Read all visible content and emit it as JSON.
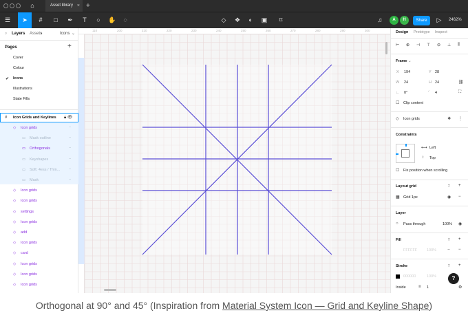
{
  "window": {
    "tab_title": "Asset library",
    "home_icon": "home-icon",
    "close_glyph": "×",
    "new_tab_glyph": "+"
  },
  "toolbar": {
    "share_label": "Share",
    "zoom_label": "2462%",
    "avatars": [
      {
        "initial": "A",
        "color": "#2fb344"
      },
      {
        "initial": "H",
        "color": "#3ab54a"
      }
    ]
  },
  "left_panel": {
    "tabs": {
      "layers": "Layers",
      "assets": "Assets",
      "assets_dot": "•",
      "page_select": "Icons"
    },
    "pages_heading": "Pages",
    "pages": [
      "Cover",
      "Colour",
      "Icons",
      "Illustrations",
      "State Fills"
    ],
    "current_page_index": 2,
    "frame_layer": "Icon Grids and Keylines",
    "layers": [
      {
        "label": "Icon grids",
        "style": "purple",
        "indent": 1
      },
      {
        "label": "Mask outline",
        "style": "grey",
        "indent": 2
      },
      {
        "label": "Orthogonals",
        "style": "purple",
        "indent": 2
      },
      {
        "label": "Keyshapes",
        "style": "grey",
        "indent": 2
      },
      {
        "label": "Soft: 4ess / Thin...",
        "style": "grey",
        "indent": 2
      },
      {
        "label": "Mask",
        "style": "grey",
        "indent": 2
      },
      {
        "label": "Icon grids",
        "style": "purple",
        "indent": 1
      },
      {
        "label": "Icon grids",
        "style": "purple",
        "indent": 1
      },
      {
        "label": "settings",
        "style": "purple",
        "indent": 1
      },
      {
        "label": "Icon grids",
        "style": "purple",
        "indent": 1
      },
      {
        "label": "add",
        "style": "purple",
        "indent": 1
      },
      {
        "label": "Icon grids",
        "style": "purple",
        "indent": 1
      },
      {
        "label": "card",
        "style": "purple",
        "indent": 1
      },
      {
        "label": "Icon grids",
        "style": "purple",
        "indent": 1
      },
      {
        "label": "Icon grids",
        "style": "purple",
        "indent": 1
      },
      {
        "label": "Icon grids",
        "style": "purple",
        "indent": 1
      }
    ]
  },
  "canvas": {
    "ruler_labels": [
      "110",
      "200",
      "210",
      "220",
      "230",
      "240",
      "250",
      "260",
      "270",
      "280",
      "290",
      "300"
    ],
    "line_color": "#5b4fd6"
  },
  "right_panel": {
    "tabs": {
      "design": "Design",
      "prototype": "Prototype",
      "inspect": "Inspect"
    },
    "frame_heading": "Frame",
    "x_label": "X",
    "x_value": "194",
    "y_label": "Y",
    "y_value": "28",
    "w_label": "W",
    "w_value": "24",
    "h_label": "H",
    "h_value": "24",
    "rotation_value": "0°",
    "radius_value": "4",
    "clip_content_label": "Clip content",
    "component_name": "Icon grids",
    "constraints_heading": "Constraints",
    "constraint_h": "Left",
    "constraint_v": "Top",
    "fix_position_label": "Fix position when scrolling",
    "layout_grid_heading": "Layout grid",
    "grid_label": "Grid 1px",
    "layer_heading": "Layer",
    "blend_mode": "Pass through",
    "layer_opacity": "100%",
    "fill_heading": "Fill",
    "fill_hex": "FFFFFF",
    "fill_opacity": "100%",
    "stroke_heading": "Stroke",
    "stroke_hex": "000000",
    "stroke_opacity": "100%",
    "stroke_align": "Inside",
    "stroke_weight": "1",
    "help_glyph": "?"
  },
  "caption": {
    "prefix": "Orthogonal at 90° and 45° (Inspiration from ",
    "link": "Material System Icon — Grid and Keyline Shape",
    "suffix": ")"
  }
}
